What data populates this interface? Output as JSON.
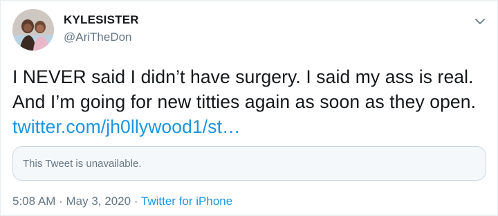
{
  "user": {
    "display_name": "KYLESISTER",
    "handle": "@AriTheDon"
  },
  "tweet": {
    "text": "I NEVER said I didn’t have surgery. I said my ass is real. And I’m going for new titties again as soon as they open.",
    "link_text": "twitter.com/jh0llywood1/st…"
  },
  "quoted": {
    "unavailable_text": "This Tweet is unavailable."
  },
  "meta": {
    "time": "5:08 AM",
    "separator_1": "·",
    "date": "May 3, 2020",
    "separator_2": "·",
    "source": "Twitter for iPhone"
  },
  "icons": {
    "caret": "chevron-down-icon"
  },
  "colors": {
    "text": "#14171a",
    "secondary": "#657786",
    "link": "#1b95e0",
    "border": "#ccd6dd"
  }
}
